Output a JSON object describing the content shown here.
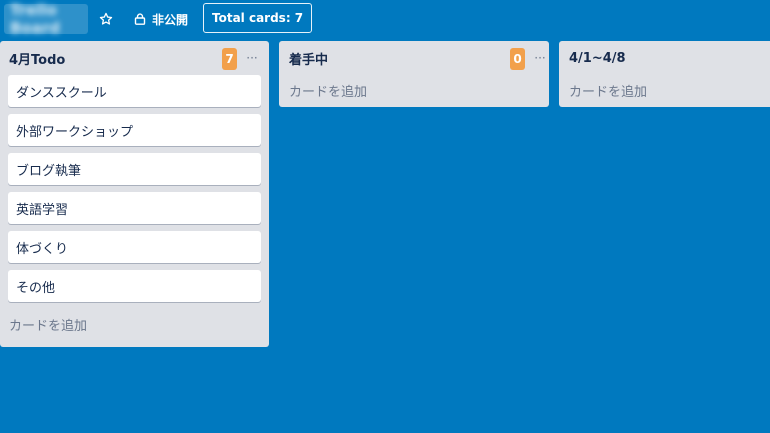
{
  "header": {
    "board_name": "Trello Board",
    "star_icon": "star-icon",
    "visibility_label": "非公開",
    "total_cards_label": "Total cards: 7"
  },
  "lists": [
    {
      "title": "4月Todo",
      "count": "7",
      "more_label": "···",
      "cards": [
        "ダンススクール",
        "外部ワークショップ",
        "ブログ執筆",
        "英語学習",
        "体づくり",
        "その他"
      ],
      "add_card_label": "カードを追加"
    },
    {
      "title": "着手中",
      "count": "0",
      "more_label": "···",
      "cards": [],
      "add_card_label": "カードを追加"
    },
    {
      "title": "4/1~4/8",
      "cards": [],
      "add_card_label": "カードを追加"
    }
  ],
  "colors": {
    "board_bg": "#0079bf",
    "list_bg": "#dfe1e6",
    "badge": "#f2a04b"
  }
}
